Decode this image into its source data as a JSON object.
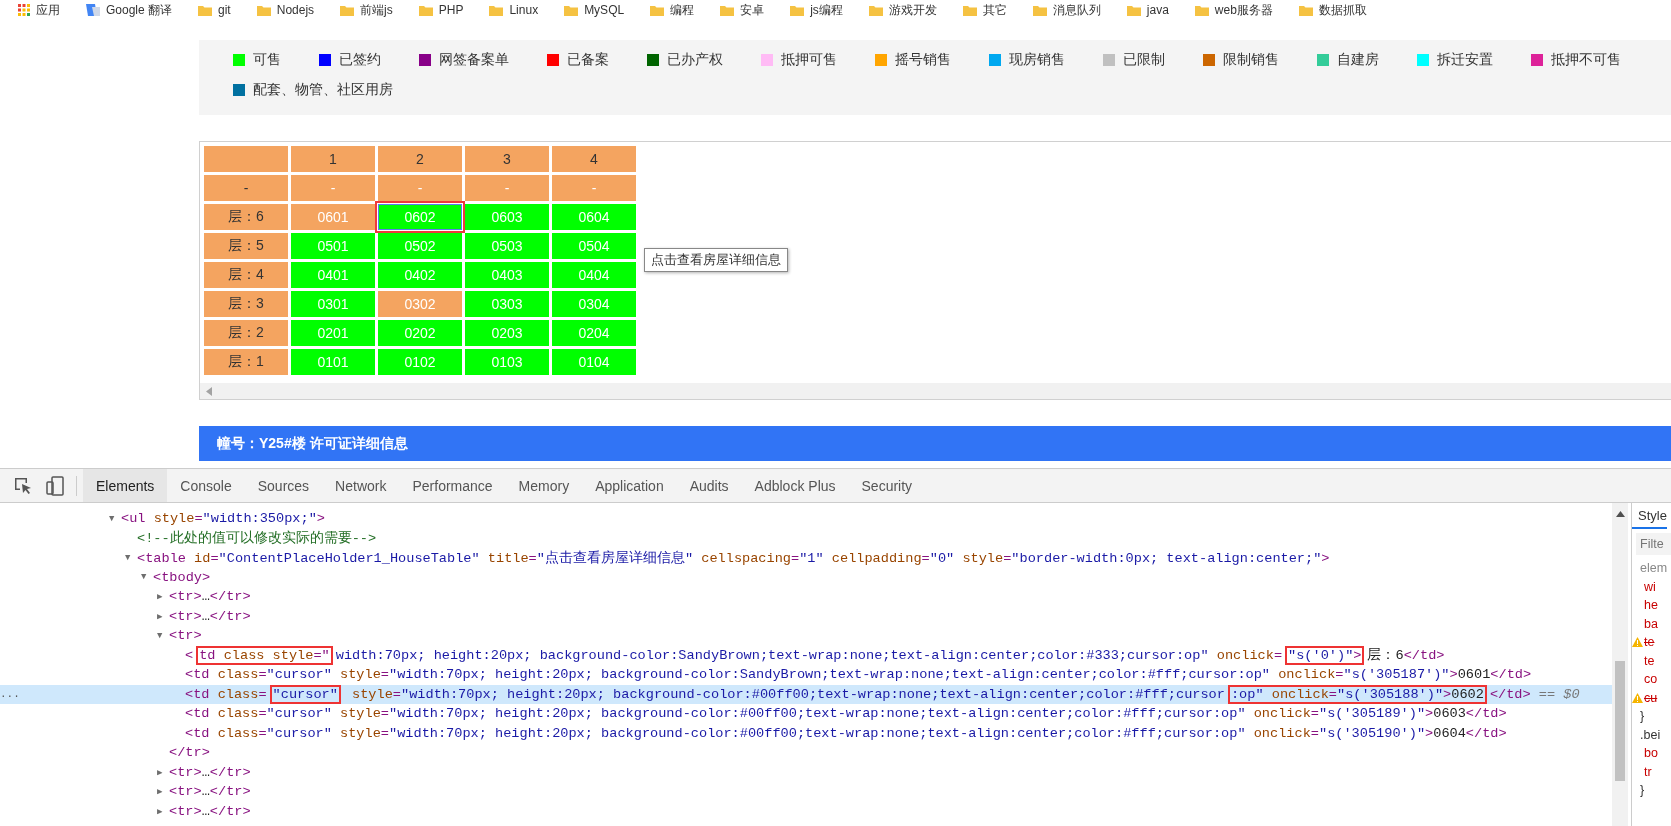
{
  "bookmarks": [
    {
      "kind": "apps",
      "label": "应用"
    },
    {
      "kind": "translate",
      "label": "Google 翻译"
    },
    {
      "kind": "folder",
      "label": "git"
    },
    {
      "kind": "folder",
      "label": "Nodejs"
    },
    {
      "kind": "folder",
      "label": "前端js"
    },
    {
      "kind": "folder",
      "label": "PHP"
    },
    {
      "kind": "folder",
      "label": "Linux"
    },
    {
      "kind": "folder",
      "label": "MySQL"
    },
    {
      "kind": "folder",
      "label": "编程"
    },
    {
      "kind": "folder",
      "label": "安卓"
    },
    {
      "kind": "folder",
      "label": "js编程"
    },
    {
      "kind": "folder",
      "label": "游戏开发"
    },
    {
      "kind": "folder",
      "label": "其它"
    },
    {
      "kind": "folder",
      "label": "消息队列"
    },
    {
      "kind": "folder",
      "label": "java"
    },
    {
      "kind": "folder",
      "label": "web服务器"
    },
    {
      "kind": "folder",
      "label": "数据抓取"
    }
  ],
  "legend": [
    {
      "label": "可售",
      "color": "#00ff00"
    },
    {
      "label": "已签约",
      "color": "#0000ff"
    },
    {
      "label": "网签备案单",
      "color": "#880088"
    },
    {
      "label": "已备案",
      "color": "#ff0000"
    },
    {
      "label": "已办产权",
      "color": "#006400"
    },
    {
      "label": "抵押可售",
      "color": "#ffbbf5"
    },
    {
      "label": "摇号销售",
      "color": "#ffa500"
    },
    {
      "label": "现房销售",
      "color": "#00a8f0"
    },
    {
      "label": "已限制",
      "color": "#c0c0c0"
    },
    {
      "label": "限制销售",
      "color": "#cc6600"
    },
    {
      "label": "自建房",
      "color": "#33cc99"
    },
    {
      "label": "拆迁安置",
      "color": "#00ffff"
    },
    {
      "label": "抵押不可售",
      "color": "#dd2299"
    },
    {
      "label": "配套、物管、社区用房",
      "color": "#0070a0"
    }
  ],
  "house_table": {
    "columns": [
      "1",
      "2",
      "3",
      "4"
    ],
    "rows": [
      {
        "label": "-",
        "cells": [
          {
            "text": "-",
            "color": "#f4a460",
            "highlighted": false
          },
          {
            "text": "-",
            "color": "#f4a460",
            "highlighted": false
          },
          {
            "text": "-",
            "color": "#f4a460",
            "highlighted": false
          },
          {
            "text": "-",
            "color": "#f4a460",
            "highlighted": false
          }
        ]
      },
      {
        "label": "层：6",
        "cells": [
          {
            "text": "0601",
            "color": "#f4a460",
            "highlighted": false
          },
          {
            "text": "0602",
            "color": "#00ff00",
            "highlighted": true
          },
          {
            "text": "0603",
            "color": "#00ff00",
            "highlighted": false
          },
          {
            "text": "0604",
            "color": "#00ff00",
            "highlighted": false
          }
        ]
      },
      {
        "label": "层：5",
        "cells": [
          {
            "text": "0501",
            "color": "#00ff00",
            "highlighted": false
          },
          {
            "text": "0502",
            "color": "#00ff00",
            "highlighted": false
          },
          {
            "text": "0503",
            "color": "#00ff00",
            "highlighted": false
          },
          {
            "text": "0504",
            "color": "#00ff00",
            "highlighted": false
          }
        ]
      },
      {
        "label": "层：4",
        "cells": [
          {
            "text": "0401",
            "color": "#00ff00",
            "highlighted": false
          },
          {
            "text": "0402",
            "color": "#00ff00",
            "highlighted": false
          },
          {
            "text": "0403",
            "color": "#00ff00",
            "highlighted": false
          },
          {
            "text": "0404",
            "color": "#00ff00",
            "highlighted": false
          }
        ]
      },
      {
        "label": "层：3",
        "cells": [
          {
            "text": "0301",
            "color": "#00ff00",
            "highlighted": false
          },
          {
            "text": "0302",
            "color": "#f4a460",
            "highlighted": false
          },
          {
            "text": "0303",
            "color": "#00ff00",
            "highlighted": false
          },
          {
            "text": "0304",
            "color": "#00ff00",
            "highlighted": false
          }
        ]
      },
      {
        "label": "层：2",
        "cells": [
          {
            "text": "0201",
            "color": "#00ff00",
            "highlighted": false
          },
          {
            "text": "0202",
            "color": "#00ff00",
            "highlighted": false
          },
          {
            "text": "0203",
            "color": "#00ff00",
            "highlighted": false
          },
          {
            "text": "0204",
            "color": "#00ff00",
            "highlighted": false
          }
        ]
      },
      {
        "label": "层：1",
        "cells": [
          {
            "text": "0101",
            "color": "#00ff00",
            "highlighted": false
          },
          {
            "text": "0102",
            "color": "#00ff00",
            "highlighted": false
          },
          {
            "text": "0103",
            "color": "#00ff00",
            "highlighted": false
          },
          {
            "text": "0104",
            "color": "#00ff00",
            "highlighted": false
          }
        ]
      }
    ],
    "tooltip": "点击查看房屋详细信息"
  },
  "banner": "幢号：Y25#楼 许可证详细信息",
  "devtools": {
    "tabs": [
      {
        "label": "Elements",
        "selected": true
      },
      {
        "label": "Console",
        "selected": false
      },
      {
        "label": "Sources",
        "selected": false
      },
      {
        "label": "Network",
        "selected": false
      },
      {
        "label": "Performance",
        "selected": false
      },
      {
        "label": "Memory",
        "selected": false
      },
      {
        "label": "Application",
        "selected": false
      },
      {
        "label": "Audits",
        "selected": false
      },
      {
        "label": "Adblock Plus",
        "selected": false
      },
      {
        "label": "Security",
        "selected": false
      }
    ],
    "dom_tree": [
      {
        "toggle": "▼",
        "selected": false,
        "tokens": [
          {
            "kind": "tag",
            "text": "<ul"
          },
          {
            "kind": "attr",
            "text": " style"
          },
          {
            "kind": "punct",
            "text": "="
          },
          {
            "kind": "val",
            "text": "\"width:350px;\""
          },
          {
            "kind": "tag",
            "text": ">"
          }
        ],
        "children": [
          {
            "selected": false,
            "tokens": [
              {
                "kind": "comment",
                "text": "<!--此处的值可以修改实际的需要-->"
              }
            ]
          },
          {
            "toggle": "▼",
            "selected": false,
            "tokens": [
              {
                "kind": "tag",
                "text": "<table"
              },
              {
                "kind": "attr",
                "text": " id"
              },
              {
                "kind": "punct",
                "text": "="
              },
              {
                "kind": "val",
                "text": "\"ContentPlaceHolder1_HouseTable\""
              },
              {
                "kind": "attr",
                "text": " title"
              },
              {
                "kind": "punct",
                "text": "="
              },
              {
                "kind": "val",
                "text": "\"点击查看房屋详细信息\""
              },
              {
                "kind": "attr",
                "text": " cellspacing"
              },
              {
                "kind": "punct",
                "text": "="
              },
              {
                "kind": "val",
                "text": "\"1\""
              },
              {
                "kind": "attr",
                "text": " cellpadding"
              },
              {
                "kind": "punct",
                "text": "="
              },
              {
                "kind": "val",
                "text": "\"0\""
              },
              {
                "kind": "attr",
                "text": " style"
              },
              {
                "kind": "punct",
                "text": "="
              },
              {
                "kind": "val",
                "text": "\"border-width:0px; text-align:center;\""
              },
              {
                "kind": "tag",
                "text": ">"
              }
            ],
            "children": [
              {
                "toggle": "▼",
                "selected": false,
                "tokens": [
                  {
                    "kind": "tag",
                    "text": "<tbody>"
                  }
                ],
                "children": [
                  {
                    "toggle": "▶",
                    "selected": false,
                    "tokens": [
                      {
                        "kind": "tag",
                        "text": "<tr>"
                      },
                      {
                        "kind": "text",
                        "text": "…"
                      },
                      {
                        "kind": "tag",
                        "text": "</tr>"
                      }
                    ]
                  },
                  {
                    "toggle": "▶",
                    "selected": false,
                    "tokens": [
                      {
                        "kind": "tag",
                        "text": "<tr>"
                      },
                      {
                        "kind": "text",
                        "text": "…"
                      },
                      {
                        "kind": "tag",
                        "text": "</tr>"
                      }
                    ]
                  },
                  {
                    "toggle": "▼",
                    "selected": false,
                    "tokens": [
                      {
                        "kind": "tag",
                        "text": "<tr>"
                      }
                    ],
                    "close": [
                      {
                        "kind": "tag",
                        "text": "</tr>"
                      }
                    ],
                    "children": [
                      {
                        "selected": false,
                        "tokens": [
                          {
                            "kind": "tag",
                            "text": "<"
                          },
                          {
                            "kind": "box",
                            "parts": [
                              {
                                "kind": "tag",
                                "text": "td"
                              },
                              {
                                "kind": "attr",
                                "text": " class style"
                              },
                              {
                                "kind": "punct",
                                "text": "=\""
                              }
                            ]
                          },
                          {
                            "kind": "val",
                            "text": "width:70px; height:20px; background-color:SandyBrown;text-wrap:none;text-align:center;color:#333;cursor:op\""
                          },
                          {
                            "kind": "attr",
                            "text": " onclick"
                          },
                          {
                            "kind": "punct",
                            "text": "="
                          },
                          {
                            "kind": "box",
                            "parts": [
                              {
                                "kind": "val",
                                "text": "\"s('0')\""
                              },
                              {
                                "kind": "tag",
                                "text": ">"
                              }
                            ]
                          },
                          {
                            "kind": "text",
                            "text": "层：6"
                          },
                          {
                            "kind": "tag",
                            "text": "</td>"
                          }
                        ]
                      },
                      {
                        "selected": false,
                        "tokens": [
                          {
                            "kind": "tag",
                            "text": "<td"
                          },
                          {
                            "kind": "attr",
                            "text": " class"
                          },
                          {
                            "kind": "punct",
                            "text": "="
                          },
                          {
                            "kind": "val",
                            "text": "\"cursor\""
                          },
                          {
                            "kind": "attr",
                            "text": " style"
                          },
                          {
                            "kind": "punct",
                            "text": "="
                          },
                          {
                            "kind": "val",
                            "text": "\"width:70px; height:20px; background-color:SandyBrown;text-wrap:none;text-align:center;color:#fff;cursor:op\""
                          },
                          {
                            "kind": "attr",
                            "text": " onclick"
                          },
                          {
                            "kind": "punct",
                            "text": "="
                          },
                          {
                            "kind": "val",
                            "text": "\"s('305187')\""
                          },
                          {
                            "kind": "tag",
                            "text": ">"
                          },
                          {
                            "kind": "text",
                            "text": "0601"
                          },
                          {
                            "kind": "tag",
                            "text": "</td>"
                          }
                        ]
                      },
                      {
                        "selected": true,
                        "gutter_mark": "...",
                        "tokens": [
                          {
                            "kind": "tag",
                            "text": "<td"
                          },
                          {
                            "kind": "attr",
                            "text": " class"
                          },
                          {
                            "kind": "punct",
                            "text": "="
                          },
                          {
                            "kind": "box",
                            "parts": [
                              {
                                "kind": "val",
                                "text": "\"cursor\""
                              }
                            ]
                          },
                          {
                            "kind": "attr",
                            "text": " style"
                          },
                          {
                            "kind": "punct",
                            "text": "="
                          },
                          {
                            "kind": "val",
                            "text": "\"width:70px; height:20px; background-color:#00ff00;text-wrap:none;text-align:center;color:#fff;cursor"
                          },
                          {
                            "kind": "box",
                            "parts": [
                              {
                                "kind": "val",
                                "text": ":op\""
                              },
                              {
                                "kind": "attr",
                                "text": " onclick"
                              },
                              {
                                "kind": "punct",
                                "text": "="
                              },
                              {
                                "kind": "val",
                                "text": "\"s('305188')\""
                              },
                              {
                                "kind": "tag",
                                "text": ">"
                              },
                              {
                                "kind": "text",
                                "text": "0602"
                              }
                            ]
                          },
                          {
                            "kind": "tag",
                            "text": "</td>"
                          },
                          {
                            "kind": "note",
                            "text": " == $0"
                          }
                        ]
                      },
                      {
                        "selected": false,
                        "tokens": [
                          {
                            "kind": "tag",
                            "text": "<td"
                          },
                          {
                            "kind": "attr",
                            "text": " class"
                          },
                          {
                            "kind": "punct",
                            "text": "="
                          },
                          {
                            "kind": "val",
                            "text": "\"cursor\""
                          },
                          {
                            "kind": "attr",
                            "text": " style"
                          },
                          {
                            "kind": "punct",
                            "text": "="
                          },
                          {
                            "kind": "val",
                            "text": "\"width:70px; height:20px; background-color:#00ff00;text-wrap:none;text-align:center;color:#fff;cursor:op\""
                          },
                          {
                            "kind": "attr",
                            "text": " onclick"
                          },
                          {
                            "kind": "punct",
                            "text": "="
                          },
                          {
                            "kind": "val",
                            "text": "\"s('305189')\""
                          },
                          {
                            "kind": "tag",
                            "text": ">"
                          },
                          {
                            "kind": "text",
                            "text": "0603"
                          },
                          {
                            "kind": "tag",
                            "text": "</td>"
                          }
                        ]
                      },
                      {
                        "selected": false,
                        "tokens": [
                          {
                            "kind": "tag",
                            "text": "<td"
                          },
                          {
                            "kind": "attr",
                            "text": " class"
                          },
                          {
                            "kind": "punct",
                            "text": "="
                          },
                          {
                            "kind": "val",
                            "text": "\"cursor\""
                          },
                          {
                            "kind": "attr",
                            "text": " style"
                          },
                          {
                            "kind": "punct",
                            "text": "="
                          },
                          {
                            "kind": "val",
                            "text": "\"width:70px; height:20px; background-color:#00ff00;text-wrap:none;text-align:center;color:#fff;cursor:op\""
                          },
                          {
                            "kind": "attr",
                            "text": " onclick"
                          },
                          {
                            "kind": "punct",
                            "text": "="
                          },
                          {
                            "kind": "val",
                            "text": "\"s('305190')\""
                          },
                          {
                            "kind": "tag",
                            "text": ">"
                          },
                          {
                            "kind": "text",
                            "text": "0604"
                          },
                          {
                            "kind": "tag",
                            "text": "</td>"
                          }
                        ]
                      }
                    ]
                  },
                  {
                    "toggle": "▶",
                    "selected": false,
                    "tokens": [
                      {
                        "kind": "tag",
                        "text": "<tr>"
                      },
                      {
                        "kind": "text",
                        "text": "…"
                      },
                      {
                        "kind": "tag",
                        "text": "</tr>"
                      }
                    ]
                  },
                  {
                    "toggle": "▶",
                    "selected": false,
                    "tokens": [
                      {
                        "kind": "tag",
                        "text": "<tr>"
                      },
                      {
                        "kind": "text",
                        "text": "…"
                      },
                      {
                        "kind": "tag",
                        "text": "</tr>"
                      }
                    ]
                  },
                  {
                    "toggle": "▶",
                    "selected": false,
                    "tokens": [
                      {
                        "kind": "tag",
                        "text": "<tr>"
                      },
                      {
                        "kind": "text",
                        "text": "…"
                      },
                      {
                        "kind": "tag",
                        "text": "</tr>"
                      }
                    ]
                  }
                ]
              }
            ]
          }
        ]
      }
    ],
    "styles_pane": {
      "tabs": [
        {
          "label": "Style",
          "selected": true
        }
      ],
      "filter_placeholder": "Filte",
      "lines": [
        {
          "kind": "selector",
          "text": "elem"
        },
        {
          "kind": "prop",
          "text": "wi"
        },
        {
          "kind": "prop",
          "text": "he"
        },
        {
          "kind": "prop",
          "text": "ba"
        },
        {
          "kind": "warn",
          "text": "te"
        },
        {
          "kind": "prop",
          "text": "te"
        },
        {
          "kind": "prop",
          "text": "co"
        },
        {
          "kind": "warn",
          "text": "cu"
        },
        {
          "kind": "brace",
          "text": "}"
        },
        {
          "kind": "rule",
          "text": ".bei"
        },
        {
          "kind": "prop",
          "text": "bo"
        },
        {
          "kind": "prop",
          "text": "tr"
        },
        {
          "kind": "brace",
          "text": "}"
        }
      ]
    }
  }
}
